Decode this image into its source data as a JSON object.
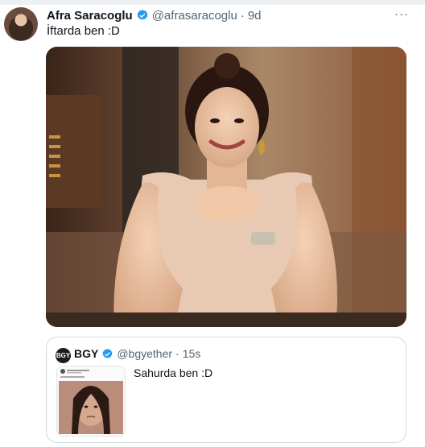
{
  "tweet": {
    "display_name": "Afra Saracoglu",
    "handle": "@afrasaracoglu",
    "separator": "·",
    "time": "9d",
    "text": "İftarda ben :D",
    "more_label": "···",
    "verified_icon": "verified-badge-icon",
    "brand_blue": "#1d9bf0"
  },
  "quote": {
    "avatar_text": "BGY",
    "display_name": "BGY",
    "handle": "@bgyether",
    "separator": "·",
    "time": "15s",
    "text": "Sahurda ben :D"
  }
}
